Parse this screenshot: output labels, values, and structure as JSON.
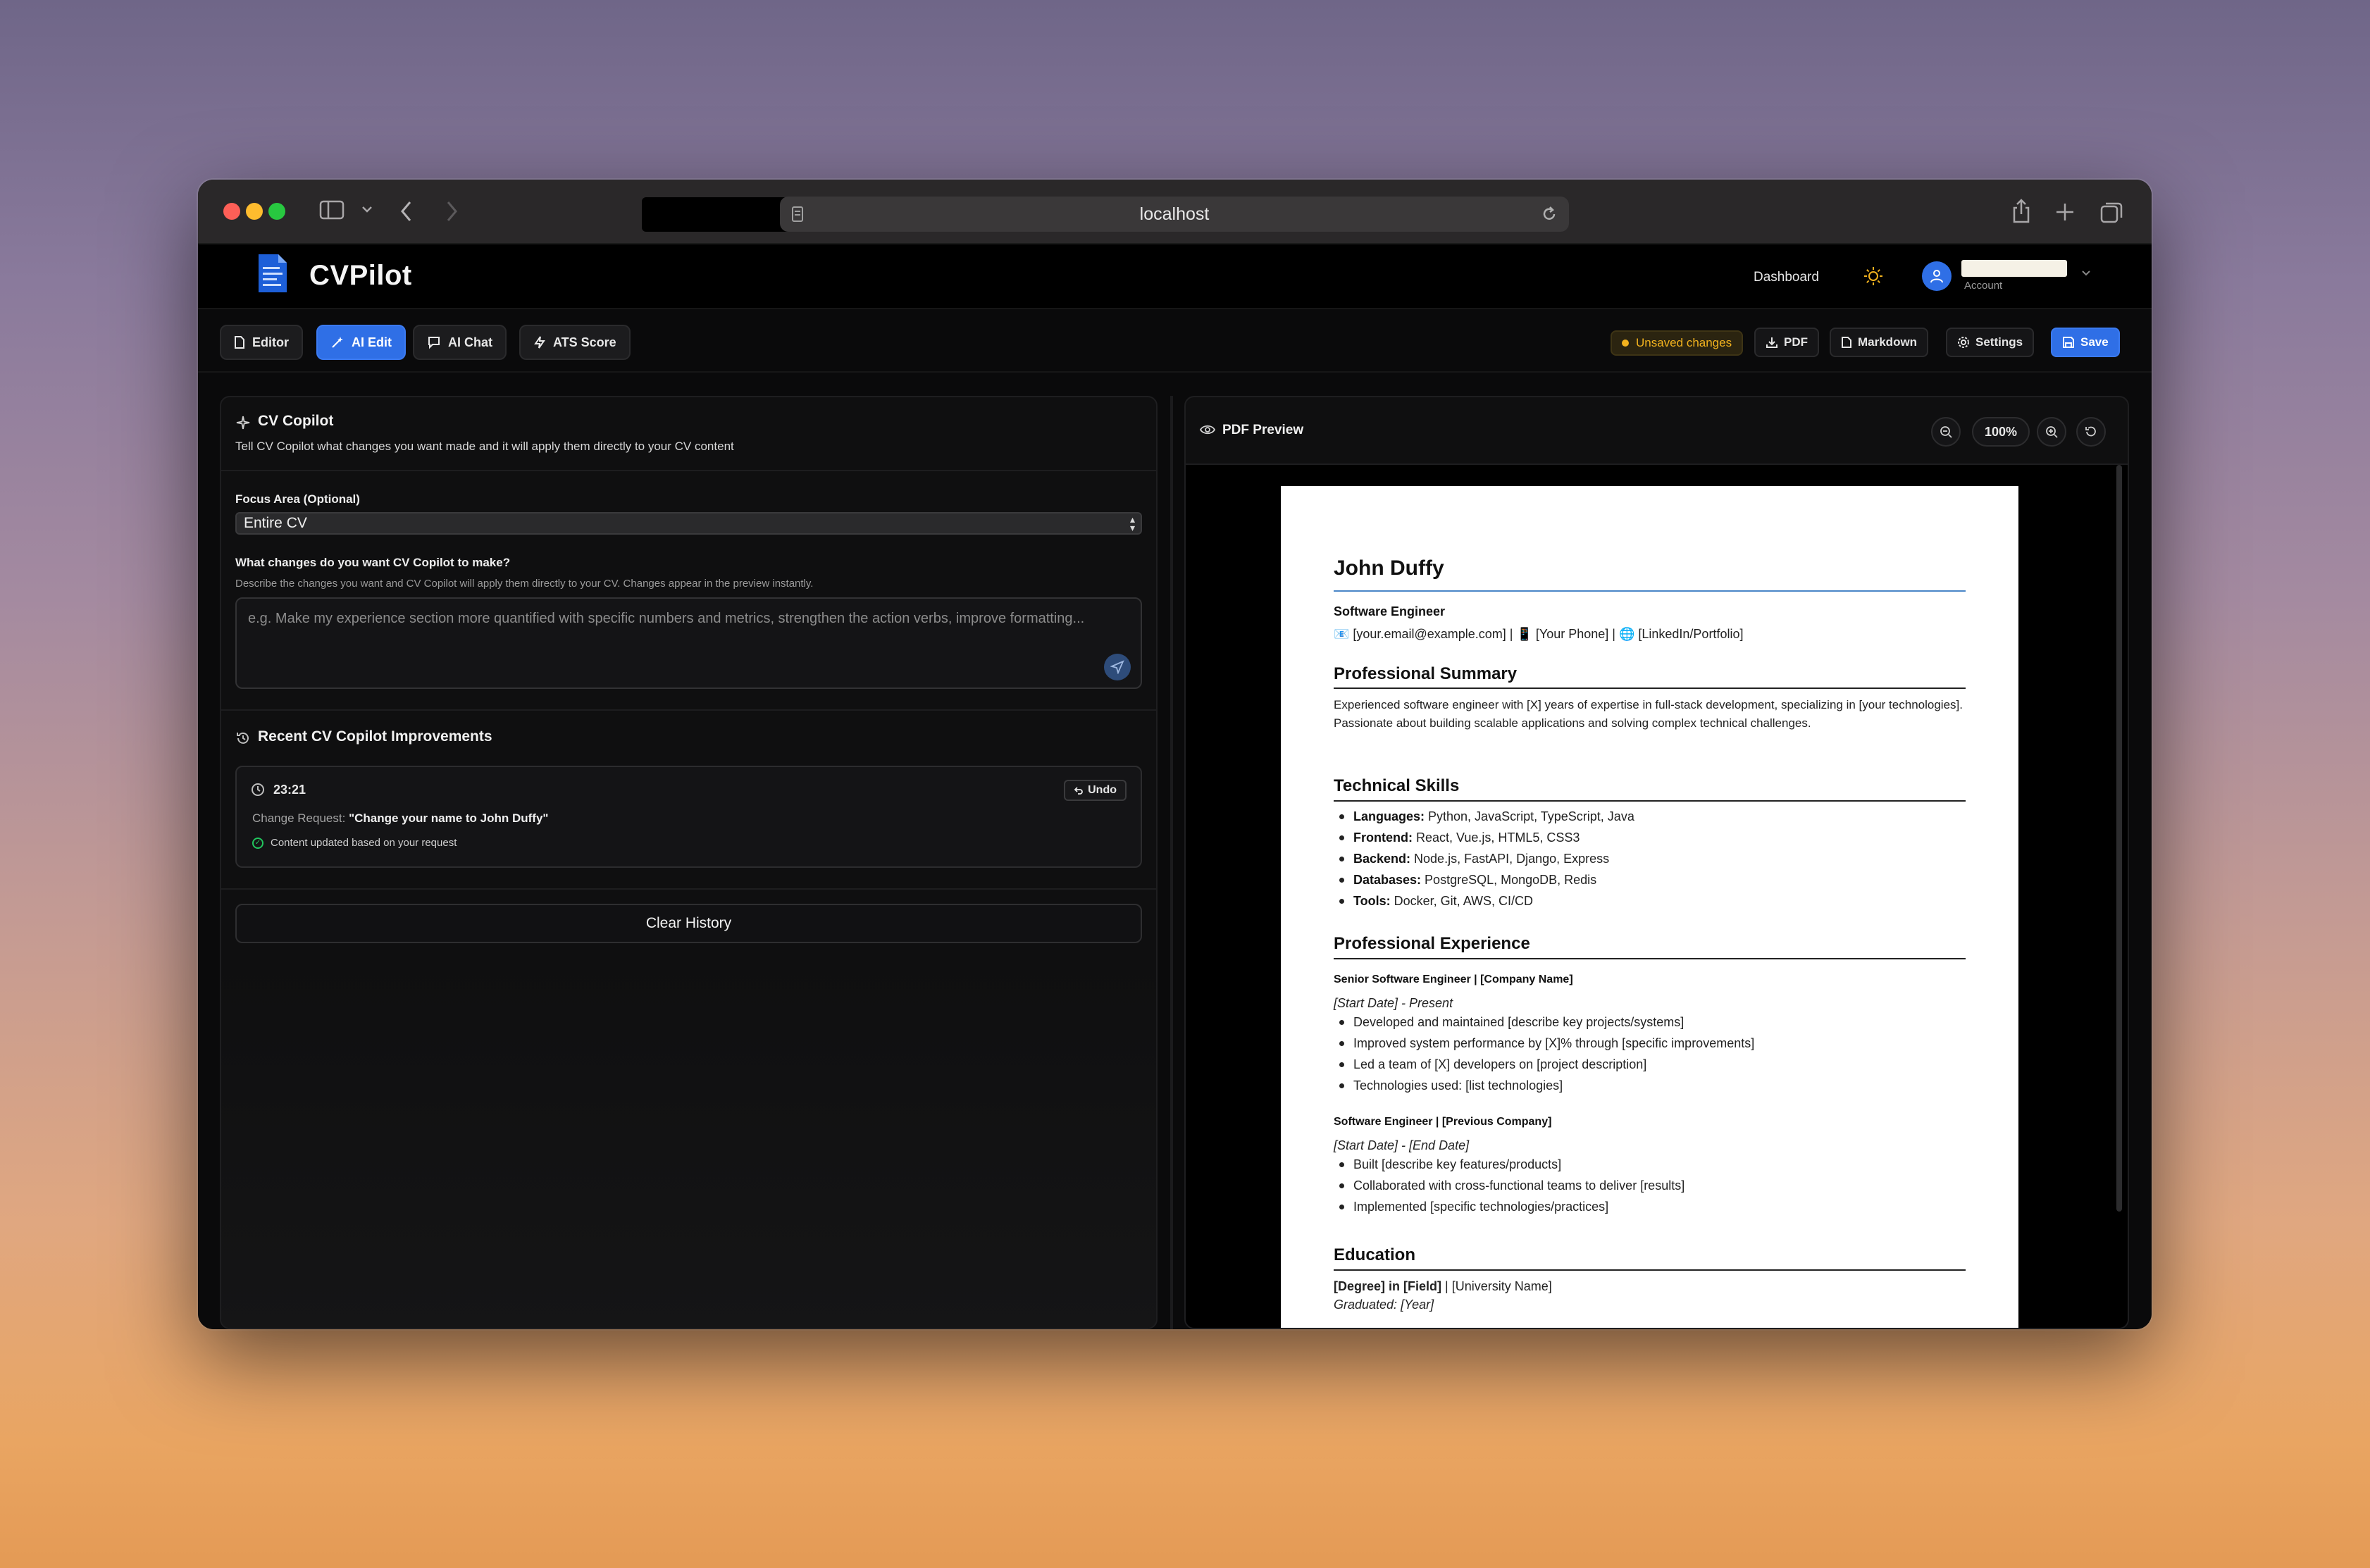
{
  "browser": {
    "url": "localhost"
  },
  "app": {
    "brand": "CVPilot",
    "nav_dashboard": "Dashboard",
    "account_label": "Account"
  },
  "toolbar": {
    "tabs": [
      {
        "label": "Editor",
        "icon": "file-icon"
      },
      {
        "label": "AI Edit",
        "icon": "wand-icon",
        "active": true
      },
      {
        "label": "AI Chat",
        "icon": "chat-icon"
      },
      {
        "label": "ATS Score",
        "icon": "bolt-icon"
      }
    ],
    "unsaved": "Unsaved changes",
    "pdf": "PDF",
    "markdown": "Markdown",
    "settings": "Settings",
    "save": "Save",
    "accent": "#2f6fe6"
  },
  "copilot": {
    "title": "CV Copilot",
    "subtitle": "Tell CV Copilot what changes you want made and it will apply them directly to your CV content",
    "focus_label": "Focus Area (Optional)",
    "focus_value": "Entire CV",
    "question_label": "What changes do you want CV Copilot to make?",
    "question_help": "Describe the changes you want and CV Copilot will apply them directly to your CV. Changes appear in the preview instantly.",
    "placeholder": "e.g. Make my experience section more quantified with specific numbers and metrics, strengthen the action verbs, improve formatting...",
    "recent_title": "Recent CV Copilot Improvements",
    "history": {
      "time": "23:21",
      "undo": "Undo",
      "request_label": "Change Request:",
      "request_text": "\"Change your name to John Duffy\"",
      "status": "Content updated based on your request"
    },
    "clear_history": "Clear History"
  },
  "preview": {
    "title": "PDF Preview",
    "zoom": "100%"
  },
  "cv": {
    "name": "John Duffy",
    "role": "Software Engineer",
    "contact": "📧 [your.email@example.com] | 📱 [Your Phone] | 🌐 [LinkedIn/Portfolio]",
    "summary_h": "Professional Summary",
    "summary": "Experienced software engineer with [X] years of expertise in full-stack development, specializing in [your technologies]. Passionate about building scalable applications and solving complex technical challenges.",
    "skills_h": "Technical Skills",
    "skills": [
      {
        "k": "Languages:",
        "v": " Python, JavaScript, TypeScript, Java"
      },
      {
        "k": "Frontend:",
        "v": " React, Vue.js, HTML5, CSS3"
      },
      {
        "k": "Backend:",
        "v": " Node.js, FastAPI, Django, Express"
      },
      {
        "k": "Databases:",
        "v": " PostgreSQL, MongoDB, Redis"
      },
      {
        "k": "Tools:",
        "v": " Docker, Git, AWS, CI/CD"
      }
    ],
    "exp_h": "Professional Experience",
    "job1": "Senior Software Engineer | [Company Name]",
    "job1_date": "[Start Date] - Present",
    "job1_items": [
      "Developed and maintained [describe key projects/systems]",
      "Improved system performance by [X]% through [specific improvements]",
      "Led a team of [X] developers on [project description]",
      "Technologies used: [list technologies]"
    ],
    "job2": "Software Engineer | [Previous Company]",
    "job2_date": "[Start Date] - [End Date]",
    "job2_items": [
      "Built [describe key features/products]",
      "Collaborated with cross-functional teams to deliver [results]",
      "Implemented [specific technologies/practices]"
    ],
    "edu_h": "Education",
    "edu_degree": "[Degree] in [Field]",
    "edu_school": " | [University Name]",
    "edu_grad_label": "Graduated:",
    "edu_grad_value": "[Year]"
  }
}
